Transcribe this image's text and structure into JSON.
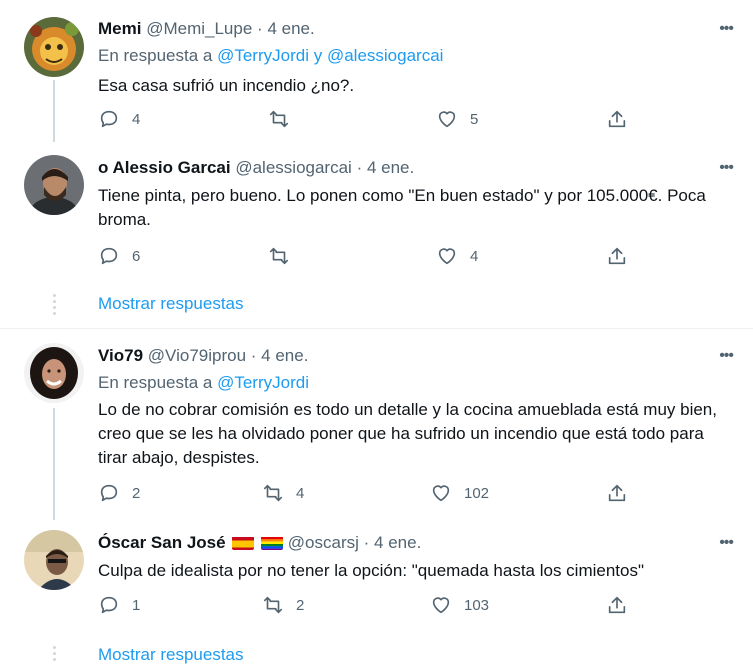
{
  "tweets": [
    {
      "name": "Memi",
      "handle": "@Memi_Lupe",
      "dot": "·",
      "date": "4 ene.",
      "reply_prefix": "En respuesta a",
      "reply_to_1": "@TerryJordi",
      "reply_joiner": "y",
      "reply_to_2": "@alessiogarcai",
      "text": "Esa casa sufrió un incendio ¿no?.",
      "replies": "4",
      "retweets": "",
      "likes": "5"
    },
    {
      "name": "o Alessio Garcai",
      "handle": "@alessiogarcai",
      "dot": "·",
      "date": "4 ene.",
      "text": "Tiene pinta, pero bueno. Lo ponen como \"En buen estado\" y por 105.000€. Poca broma.",
      "replies": "6",
      "retweets": "",
      "likes": "4"
    },
    {
      "name": "Vio79",
      "handle": "@Vio79iprou",
      "dot": "·",
      "date": "4 ene.",
      "reply_prefix": "En respuesta a",
      "reply_to_1": "@TerryJordi",
      "text": "Lo de no cobrar comisión es todo un detalle y la cocina amueblada está muy bien, creo que se les ha olvidado poner que ha sufrido un incendio que está todo para tirar abajo, despistes.",
      "replies": "2",
      "retweets": "4",
      "likes": "102"
    },
    {
      "name": "Óscar San José",
      "handle": "@oscarsj",
      "dot": "·",
      "date": "4 ene.",
      "text": "Culpa de idealista por no tener la opción: \"quemada hasta los cimientos\"",
      "replies": "1",
      "retweets": "2",
      "likes": "103"
    }
  ],
  "show_more_1": "Mostrar respuestas",
  "show_more_2": "Mostrar respuestas",
  "more_glyph": "•••",
  "colors": {
    "link": "#1d9bf0",
    "muted": "#536471",
    "line": "#cfd9de"
  }
}
